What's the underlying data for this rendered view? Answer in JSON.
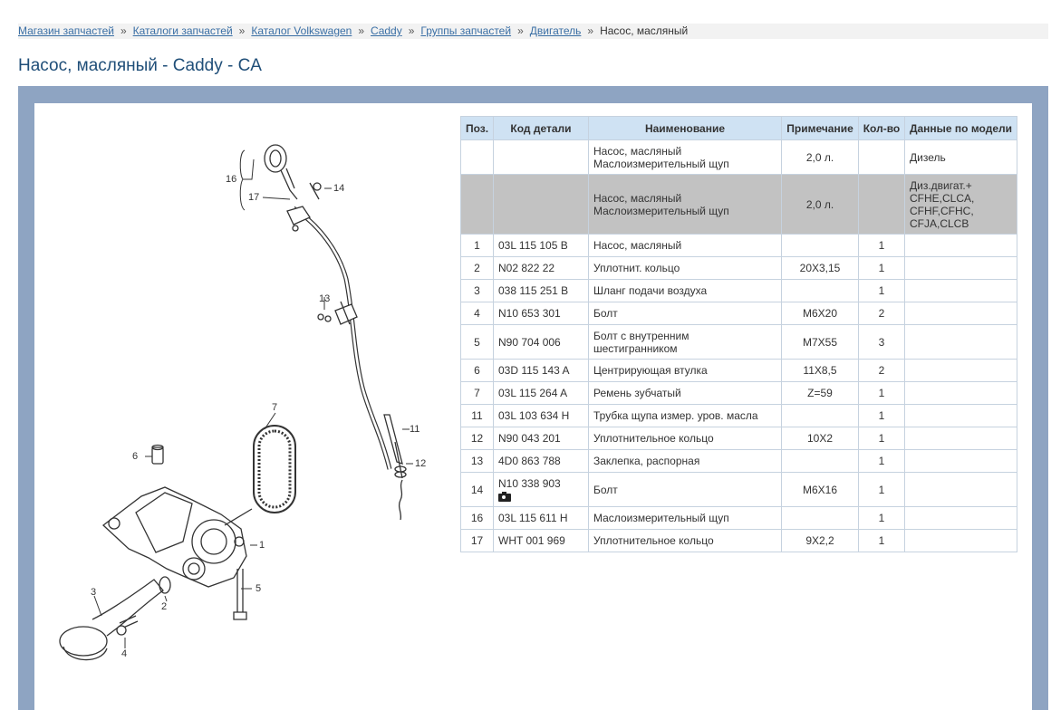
{
  "breadcrumb": {
    "links": [
      "Магазин запчастей",
      "Каталоги запчастей",
      "Каталог Volkswagen",
      "Caddy",
      "Группы запчастей",
      "Двигатель"
    ],
    "separator": "»",
    "current": "Насос, масляный"
  },
  "page_title": "Насос, масляный - Caddy - CA",
  "diagram": {
    "callouts": [
      "16",
      "17",
      "14",
      "13",
      "7",
      "11",
      "12",
      "6",
      "1",
      "5",
      "3",
      "2",
      "4"
    ]
  },
  "table": {
    "headers": [
      "Поз.",
      "Код детали",
      "Наименование",
      "Примечание",
      "Кол-во",
      "Данные по модели"
    ],
    "group_rows": [
      {
        "name": [
          "Насос, масляный",
          "Маслоизмерительный щуп"
        ],
        "note": "2,0 л.",
        "model": [
          "Дизель"
        ]
      },
      {
        "name": [
          "Насос, масляный",
          "Маслоизмерительный щуп"
        ],
        "note": "2,0 л.",
        "model": [
          "Диз.двигат.+",
          "CFHE,CLCA,",
          "CFHF,CFHC,",
          "CFJA,CLCB"
        ]
      }
    ],
    "rows": [
      {
        "pos": "1",
        "code": "03L 115 105 B",
        "name": [
          "Насос, масляный"
        ],
        "note": "",
        "qty": "1"
      },
      {
        "pos": "2",
        "code": "N02 822 22",
        "name": [
          "Уплотнит. кольцо"
        ],
        "note": "20X3,15",
        "qty": "1"
      },
      {
        "pos": "3",
        "code": "038 115 251 B",
        "name": [
          "Шланг подачи воздуха"
        ],
        "note": "",
        "qty": "1"
      },
      {
        "pos": "4",
        "code": "N10 653 301",
        "name": [
          "Болт"
        ],
        "note": "M6X20",
        "qty": "2"
      },
      {
        "pos": "5",
        "code": "N90 704 006",
        "name": [
          "Болт с внутренним",
          "шестигранником"
        ],
        "note": "M7X55",
        "qty": "3"
      },
      {
        "pos": "6",
        "code": "03D 115 143 A",
        "name": [
          "Центрирующая втулка"
        ],
        "note": "11X8,5",
        "qty": "2"
      },
      {
        "pos": "7",
        "code": "03L 115 264 A",
        "name": [
          "Ремень зубчатый"
        ],
        "note": "Z=59",
        "qty": "1"
      },
      {
        "pos": "11",
        "code": "03L 103 634 H",
        "name": [
          "Трубка щупа измер. уров. масла"
        ],
        "note": "",
        "qty": "1"
      },
      {
        "pos": "12",
        "code": "N90 043 201",
        "name": [
          "Уплотнительное кольцо"
        ],
        "note": "10X2",
        "qty": "1"
      },
      {
        "pos": "13",
        "code": "4D0 863 788",
        "name": [
          "Заклепка, распорная"
        ],
        "note": "",
        "qty": "1"
      },
      {
        "pos": "14",
        "code": "N10 338 903",
        "name": [
          "Болт"
        ],
        "note": "M6X16",
        "qty": "1",
        "camera_icon": true
      },
      {
        "pos": "16",
        "code": "03L 115 611 H",
        "name": [
          "Маслоизмерительный щуп"
        ],
        "note": "",
        "qty": "1"
      },
      {
        "pos": "17",
        "code": "WHT 001 969",
        "name": [
          "Уплотнительное кольцо"
        ],
        "note": "9X2,2",
        "qty": "1"
      }
    ]
  }
}
